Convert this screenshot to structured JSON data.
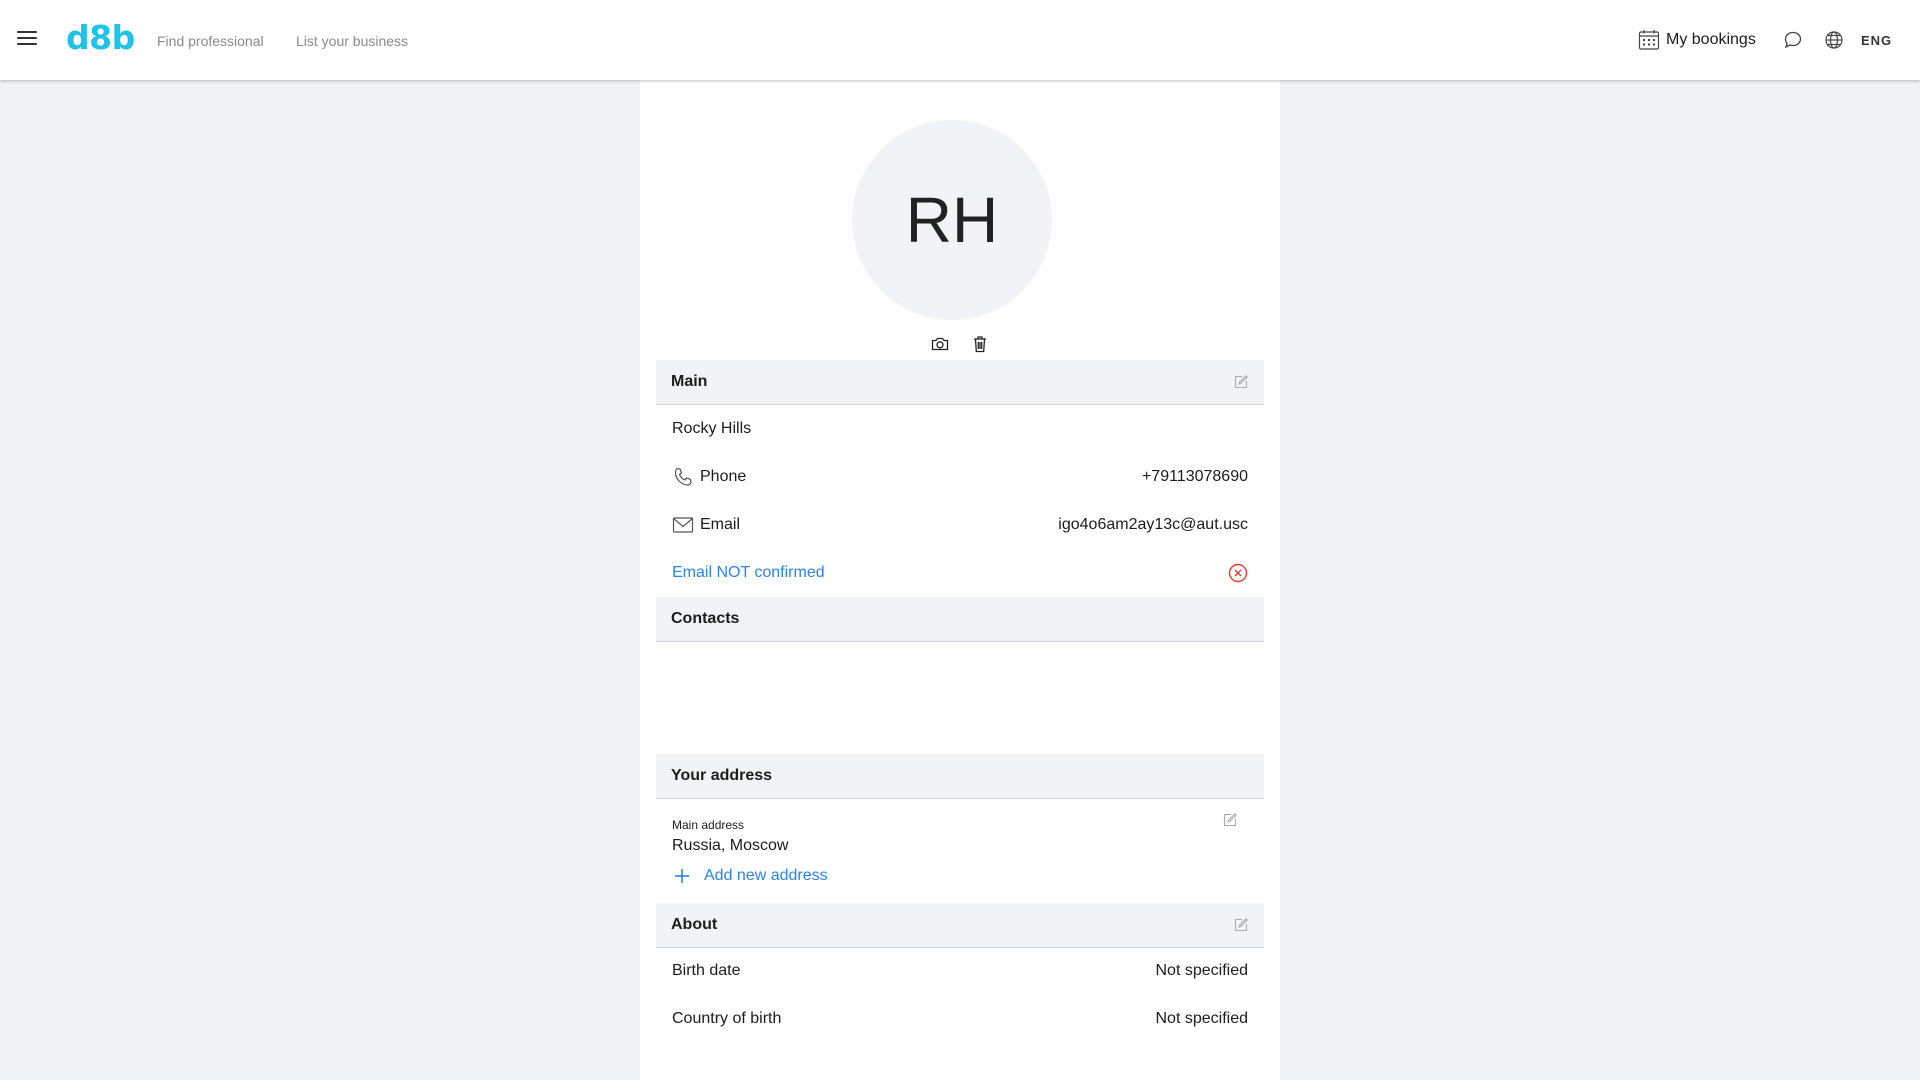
{
  "header": {
    "logo": "d8b",
    "nav": [
      "Find professional",
      "List your business"
    ],
    "bookings_label": "My bookings",
    "language": "ENG"
  },
  "profile": {
    "initials": "RH",
    "icons": [
      "camera-icon",
      "trash-icon"
    ]
  },
  "main": {
    "title": "Main",
    "name": "Rocky Hills",
    "phone_label": "Phone",
    "phone_value": "+79113078690",
    "email_label": "Email",
    "email_value": "igo4o6am2ay13c@aut.usc",
    "email_status": "Email NOT confirmed"
  },
  "contacts": {
    "title": "Contacts"
  },
  "address": {
    "title": "Your address",
    "main_label": "Main address",
    "main_value": "Russia, Moscow",
    "add_label": "Add new address"
  },
  "about": {
    "title": "About",
    "birth_date_label": "Birth date",
    "birth_date_value": "Not specified",
    "country_label": "Country of birth",
    "country_value": "Not specified"
  },
  "colors": {
    "brand": "#1ec3e6",
    "link": "#2b84e6",
    "error": "#e53935",
    "section_bg": "#f2f3f7"
  }
}
